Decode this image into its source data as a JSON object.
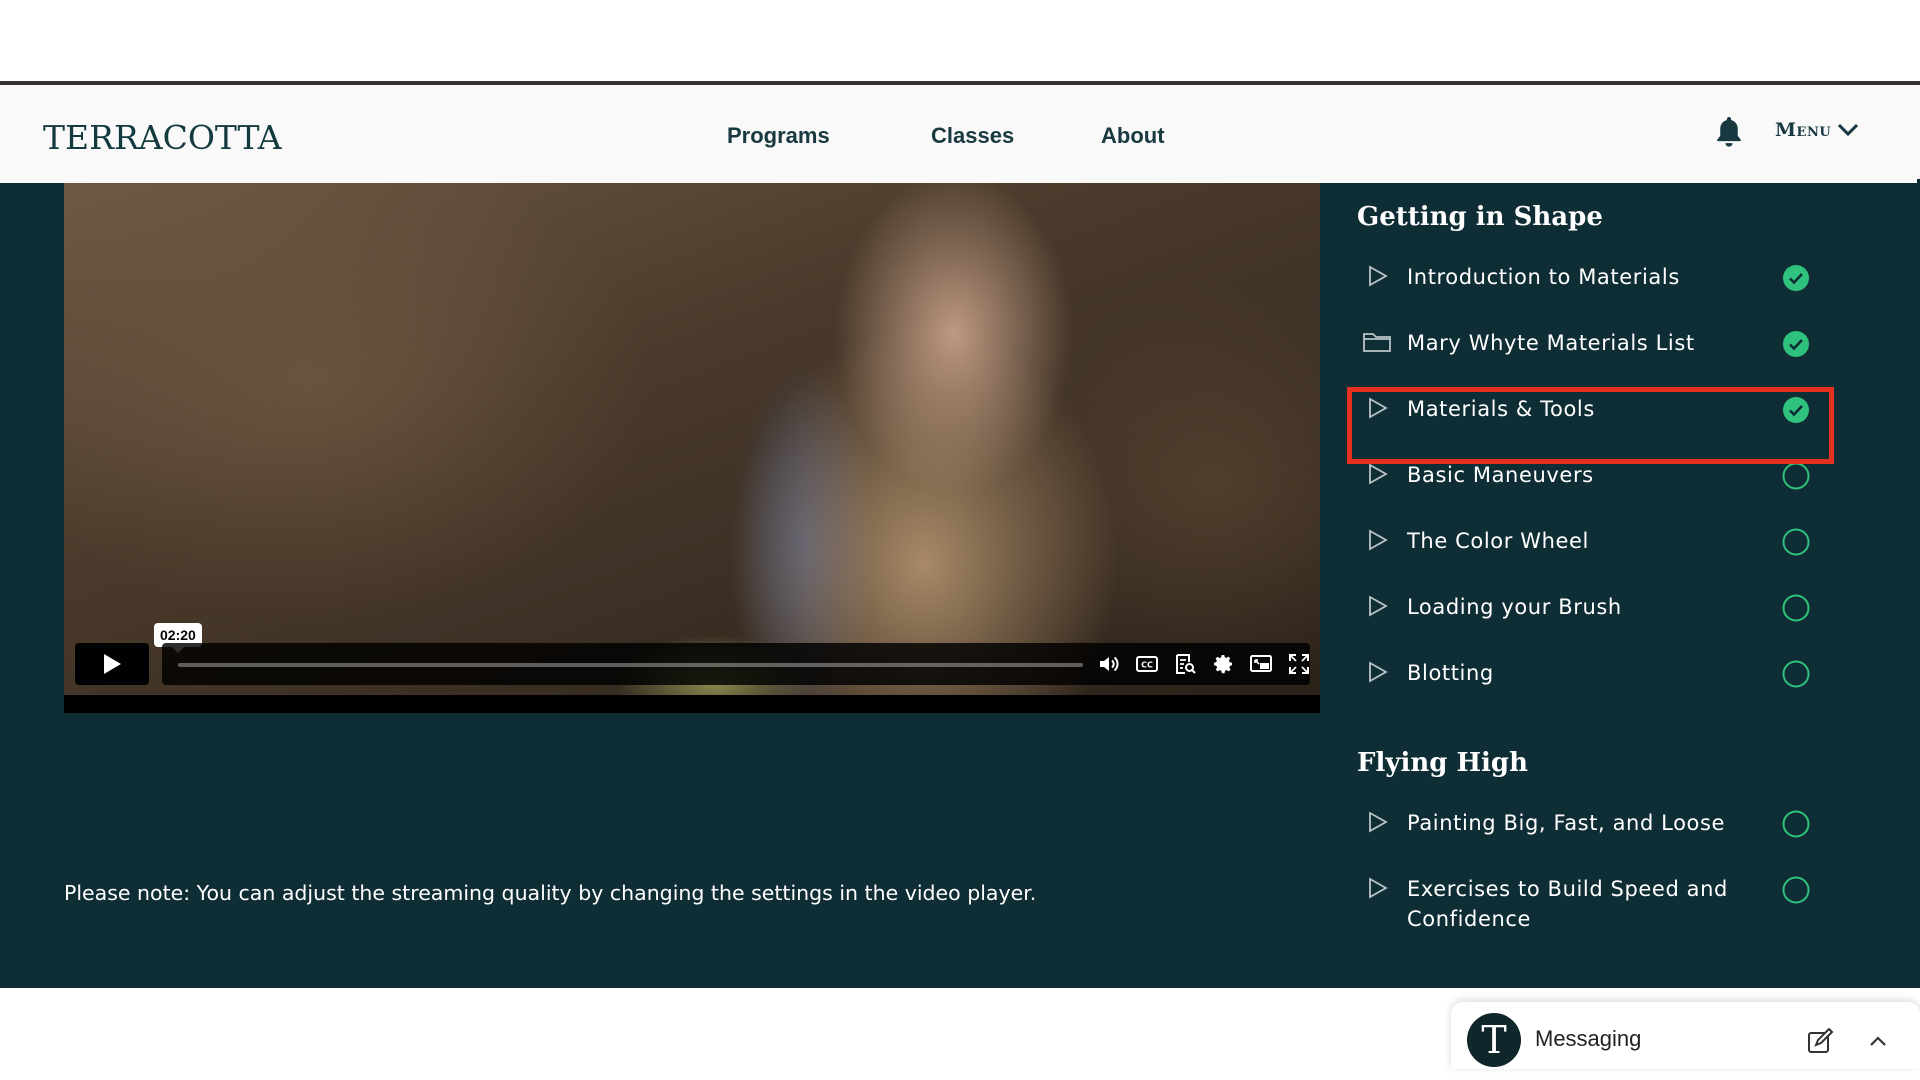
{
  "header": {
    "logo": "TERRACOTTA",
    "nav": [
      "Programs",
      "Classes",
      "About"
    ],
    "menu_label": "Menu"
  },
  "player": {
    "time_tooltip": "02:20"
  },
  "note": "Please note: You can adjust the streaming quality by changing the settings in the video player.",
  "sections": [
    {
      "title": "Getting in Shape",
      "lessons": [
        {
          "label": "Introduction to Materials",
          "icon": "play-outline-icon",
          "completed": true
        },
        {
          "label": "Mary Whyte Materials List",
          "icon": "folder-icon",
          "completed": true
        },
        {
          "label": "Materials & Tools",
          "icon": "play-outline-icon",
          "completed": true
        },
        {
          "label": "Basic Maneuvers",
          "icon": "play-outline-icon",
          "completed": false
        },
        {
          "label": "The Color Wheel",
          "icon": "play-outline-icon",
          "completed": false
        },
        {
          "label": "Loading your Brush",
          "icon": "play-outline-icon",
          "completed": false
        },
        {
          "label": "Blotting",
          "icon": "play-outline-icon",
          "completed": false
        }
      ]
    },
    {
      "title": "Flying High",
      "lessons": [
        {
          "label": "Painting Big, Fast, and Loose",
          "icon": "play-outline-icon",
          "completed": false
        },
        {
          "label": "Exercises to Build Speed and Confidence",
          "icon": "play-outline-icon",
          "completed": false
        }
      ]
    }
  ],
  "messaging": {
    "avatar_letter": "T",
    "label": "Messaging"
  },
  "colors": {
    "background": "#0f2d35",
    "complete": "#2ec27e",
    "highlight": "#e8301f",
    "brand_text": "#133a3f"
  }
}
